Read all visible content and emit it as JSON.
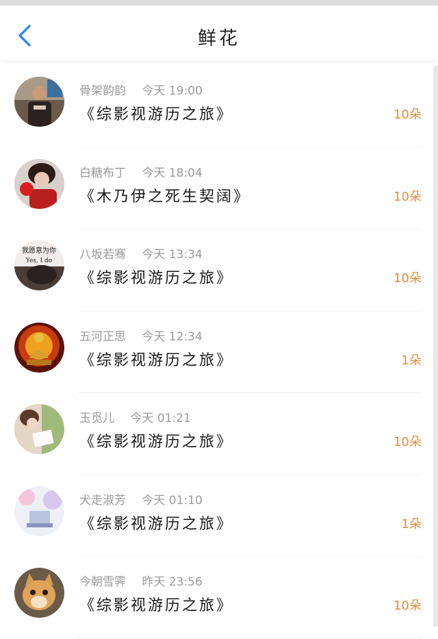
{
  "header": {
    "title": "鲜花",
    "back_icon": "chevron-left-icon",
    "accent_color": "#2d8cf0"
  },
  "items": [
    {
      "user": "骨架韵韵",
      "time": "今天 19:00",
      "book": "《综影视游历之旅》",
      "count": "10朵"
    },
    {
      "user": "白糖布丁",
      "time": "今天 18:04",
      "book": "《木乃伊之死生契阔》",
      "count": "10朵"
    },
    {
      "user": "八坂若骞",
      "time": "今天 13:34",
      "book": "《综影视游历之旅》",
      "count": "10朵",
      "avatar_text": [
        "我愿意为你",
        "Yes, I do"
      ]
    },
    {
      "user": "五河正思",
      "time": "今天 12:34",
      "book": "《综影视游历之旅》",
      "count": "1朵"
    },
    {
      "user": "玉觅儿",
      "time": "今天 01:21",
      "book": "《综影视游历之旅》",
      "count": "10朵"
    },
    {
      "user": "犬走淑芳",
      "time": "今天 01:10",
      "book": "《综影视游历之旅》",
      "count": "1朵"
    },
    {
      "user": "今朝雪霁",
      "time": "昨天 23:56",
      "book": "《综影视游历之旅》",
      "count": "10朵"
    }
  ]
}
